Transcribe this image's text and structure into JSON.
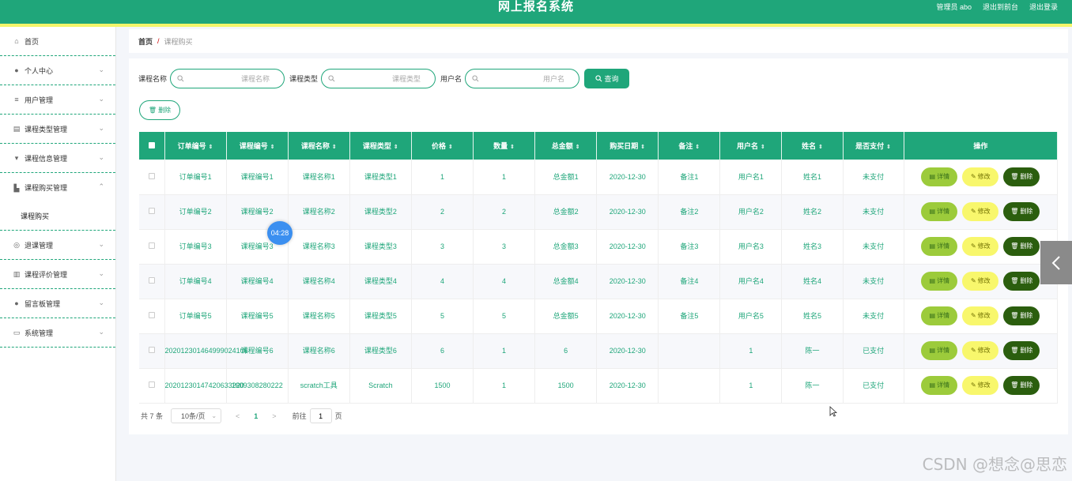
{
  "header": {
    "title": "网上报名系统",
    "admin": "管理员 abo",
    "to_front": "退出到前台",
    "logout": "退出登录"
  },
  "sidebar": {
    "items": [
      {
        "label": "首页",
        "icon": "home-icon",
        "chevron": false
      },
      {
        "label": "个人中心",
        "icon": "user-icon",
        "chevron": true
      },
      {
        "label": "用户管理",
        "icon": "list-icon",
        "chevron": true
      },
      {
        "label": "课程类型管理",
        "icon": "clipboard-icon",
        "chevron": true
      },
      {
        "label": "课程信息管理",
        "icon": "pin-icon",
        "chevron": true
      },
      {
        "label": "课程购买管理",
        "icon": "thumb-icon",
        "chevron": true,
        "open": true
      },
      {
        "label": "退课管理",
        "icon": "globe-icon",
        "chevron": true
      },
      {
        "label": "课程评价管理",
        "icon": "chart-icon",
        "chevron": true
      },
      {
        "label": "留言板管理",
        "icon": "person-icon",
        "chevron": true
      },
      {
        "label": "系统管理",
        "icon": "monitor-icon",
        "chevron": true
      }
    ],
    "submenu": {
      "label": "课程购买"
    }
  },
  "breadcrumb": {
    "home": "首页",
    "sep": "/",
    "current": "课程购买"
  },
  "search": {
    "course_name_label": "课程名称",
    "course_name_placeholder": "课程名称",
    "course_type_label": "课程类型",
    "course_type_placeholder": "课程类型",
    "username_label": "用户名",
    "username_placeholder": "用户名",
    "query_button": "查询"
  },
  "delete_button": "删除",
  "table": {
    "columns": [
      "订单编号",
      "课程编号",
      "课程名称",
      "课程类型",
      "价格",
      "数量",
      "总金额",
      "购买日期",
      "备注",
      "用户名",
      "姓名",
      "是否支付",
      "操作"
    ],
    "rows": [
      [
        "订单编号1",
        "课程编号1",
        "课程名称1",
        "课程类型1",
        "1",
        "1",
        "总金额1",
        "2020-12-30",
        "备注1",
        "用户名1",
        "姓名1",
        "未支付"
      ],
      [
        "订单编号2",
        "课程编号2",
        "课程名称2",
        "课程类型2",
        "2",
        "2",
        "总金额2",
        "2020-12-30",
        "备注2",
        "用户名2",
        "姓名2",
        "未支付"
      ],
      [
        "订单编号3",
        "课程编号3",
        "课程名称3",
        "课程类型3",
        "3",
        "3",
        "总金额3",
        "2020-12-30",
        "备注3",
        "用户名3",
        "姓名3",
        "未支付"
      ],
      [
        "订单编号4",
        "课程编号4",
        "课程名称4",
        "课程类型4",
        "4",
        "4",
        "总金额4",
        "2020-12-30",
        "备注4",
        "用户名4",
        "姓名4",
        "未支付"
      ],
      [
        "订单编号5",
        "课程编号5",
        "课程名称5",
        "课程类型5",
        "5",
        "5",
        "总金额5",
        "2020-12-30",
        "备注5",
        "用户名5",
        "姓名5",
        "未支付"
      ],
      [
        "202012301464999024106",
        "课程编号6",
        "课程名称6",
        "课程类型6",
        "6",
        "1",
        "6",
        "2020-12-30",
        "",
        "1",
        "陈一",
        "已支付"
      ],
      [
        "20201230147420633220",
        "1609308280222",
        "scratch工具",
        "Scratch",
        "1500",
        "1",
        "1500",
        "2020-12-30",
        "",
        "1",
        "陈一",
        "已支付"
      ]
    ],
    "actions": {
      "detail": "详情",
      "edit": "修改",
      "delete": "删除"
    }
  },
  "pager": {
    "total": "共 7 条",
    "page_size": "10条/页",
    "prev": "<",
    "current_page": "1",
    "next": ">",
    "goto_label": "前往",
    "goto_value": "1",
    "page_suffix": "页"
  },
  "overlay": {
    "timer": "04:28",
    "watermark": "CSDN @想念@思恋"
  },
  "colors": {
    "primary": "#1fa67a",
    "accent_yellow": "#f3f56a",
    "detail_btn": "#9ccb3b",
    "edit_btn": "#f8f76c",
    "delete_btn": "#2b5e0e"
  }
}
